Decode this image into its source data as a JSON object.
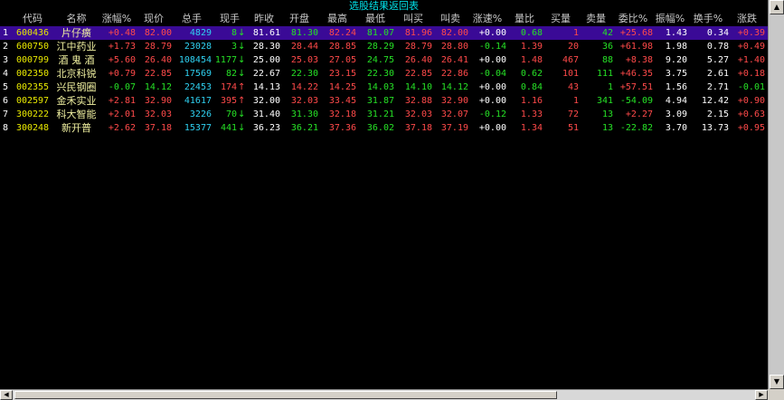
{
  "title": "选股结果返回表",
  "columns": [
    {
      "label": "代码"
    },
    {
      "label": "名称"
    },
    {
      "label": "涨幅%"
    },
    {
      "label": "现价"
    },
    {
      "label": "总手"
    },
    {
      "label": "现手"
    },
    {
      "label": "昨收"
    },
    {
      "label": "开盘"
    },
    {
      "label": "最高"
    },
    {
      "label": "最低"
    },
    {
      "label": "叫买"
    },
    {
      "label": "叫卖"
    },
    {
      "label": "涨速%"
    },
    {
      "label": "量比"
    },
    {
      "label": "买量"
    },
    {
      "label": "卖量"
    },
    {
      "label": "委比%"
    },
    {
      "label": "振幅%"
    },
    {
      "label": "换手%"
    },
    {
      "label": "涨跌"
    }
  ],
  "rows": [
    {
      "idx": "1",
      "code": "600436",
      "name": "片仔癀",
      "chg_pct": "+0.48",
      "price": "82.00",
      "vol": "4829",
      "cur": "8",
      "cur_dir": "down",
      "prev": "81.61",
      "open": "81.30",
      "high": "82.24",
      "low": "81.07",
      "bid": "81.96",
      "ask": "82.00",
      "speed": "+0.00",
      "ratio": "0.68",
      "buy": "1",
      "sell": "42",
      "wb": "+25.68",
      "amp": "1.43",
      "turn": "0.34",
      "diff": "+0.39",
      "selected": true
    },
    {
      "idx": "2",
      "code": "600750",
      "name": "江中药业",
      "chg_pct": "+1.73",
      "price": "28.79",
      "vol": "23028",
      "cur": "3",
      "cur_dir": "down",
      "prev": "28.30",
      "open": "28.44",
      "high": "28.85",
      "low": "28.29",
      "bid": "28.79",
      "ask": "28.80",
      "speed": "-0.14",
      "ratio": "1.39",
      "buy": "20",
      "sell": "36",
      "wb": "+61.98",
      "amp": "1.98",
      "turn": "0.78",
      "diff": "+0.49",
      "selected": false
    },
    {
      "idx": "3",
      "code": "000799",
      "name": "酒 鬼 酒",
      "chg_pct": "+5.60",
      "price": "26.40",
      "vol": "108454",
      "cur": "1177",
      "cur_dir": "down",
      "prev": "25.00",
      "open": "25.03",
      "high": "27.05",
      "low": "24.75",
      "bid": "26.40",
      "ask": "26.41",
      "speed": "+0.00",
      "ratio": "1.48",
      "buy": "467",
      "sell": "88",
      "wb": "+8.38",
      "amp": "9.20",
      "turn": "5.27",
      "diff": "+1.40",
      "selected": false
    },
    {
      "idx": "4",
      "code": "002350",
      "name": "北京科锐",
      "chg_pct": "+0.79",
      "price": "22.85",
      "vol": "17569",
      "cur": "82",
      "cur_dir": "down",
      "prev": "22.67",
      "open": "22.30",
      "high": "23.15",
      "low": "22.30",
      "bid": "22.85",
      "ask": "22.86",
      "speed": "-0.04",
      "ratio": "0.62",
      "buy": "101",
      "sell": "111",
      "wb": "+46.35",
      "amp": "3.75",
      "turn": "2.61",
      "diff": "+0.18",
      "selected": false
    },
    {
      "idx": "5",
      "code": "002355",
      "name": "兴民钢圈",
      "chg_pct": "-0.07",
      "price": "14.12",
      "vol": "22453",
      "cur": "174",
      "cur_dir": "up",
      "prev": "14.13",
      "open": "14.22",
      "high": "14.25",
      "low": "14.03",
      "bid": "14.10",
      "ask": "14.12",
      "speed": "+0.00",
      "ratio": "0.84",
      "buy": "43",
      "sell": "1",
      "wb": "+57.51",
      "amp": "1.56",
      "turn": "2.71",
      "diff": "-0.01",
      "selected": false
    },
    {
      "idx": "6",
      "code": "002597",
      "name": "金禾实业",
      "chg_pct": "+2.81",
      "price": "32.90",
      "vol": "41617",
      "cur": "395",
      "cur_dir": "up",
      "prev": "32.00",
      "open": "32.03",
      "high": "33.45",
      "low": "31.87",
      "bid": "32.88",
      "ask": "32.90",
      "speed": "+0.00",
      "ratio": "1.16",
      "buy": "1",
      "sell": "341",
      "wb": "-54.09",
      "amp": "4.94",
      "turn": "12.42",
      "diff": "+0.90",
      "selected": false
    },
    {
      "idx": "7",
      "code": "300222",
      "name": "科大智能",
      "chg_pct": "+2.01",
      "price": "32.03",
      "vol": "3226",
      "cur": "70",
      "cur_dir": "down",
      "prev": "31.40",
      "open": "31.30",
      "high": "32.18",
      "low": "31.21",
      "bid": "32.03",
      "ask": "32.07",
      "speed": "-0.12",
      "ratio": "1.33",
      "buy": "72",
      "sell": "13",
      "wb": "+2.27",
      "amp": "3.09",
      "turn": "2.15",
      "diff": "+0.63",
      "selected": false
    },
    {
      "idx": "8",
      "code": "300248",
      "name": "新开普",
      "chg_pct": "+2.62",
      "price": "37.18",
      "vol": "15377",
      "cur": "441",
      "cur_dir": "down",
      "prev": "36.23",
      "open": "36.21",
      "high": "37.36",
      "low": "36.02",
      "bid": "37.18",
      "ask": "37.19",
      "speed": "+0.00",
      "ratio": "1.34",
      "buy": "51",
      "sell": "13",
      "wb": "-22.82",
      "amp": "3.70",
      "turn": "13.73",
      "diff": "+0.95",
      "selected": false
    }
  ],
  "icons": {
    "up_arrow": "arrow-up-icon",
    "down_arrow": "arrow-down-icon"
  },
  "colors": {
    "up": "#ff4a4a",
    "down": "#26e026",
    "flat": "#ffffff",
    "code": "#e8e800",
    "volume": "#2fd2f2",
    "selected": "#3a0a96"
  }
}
